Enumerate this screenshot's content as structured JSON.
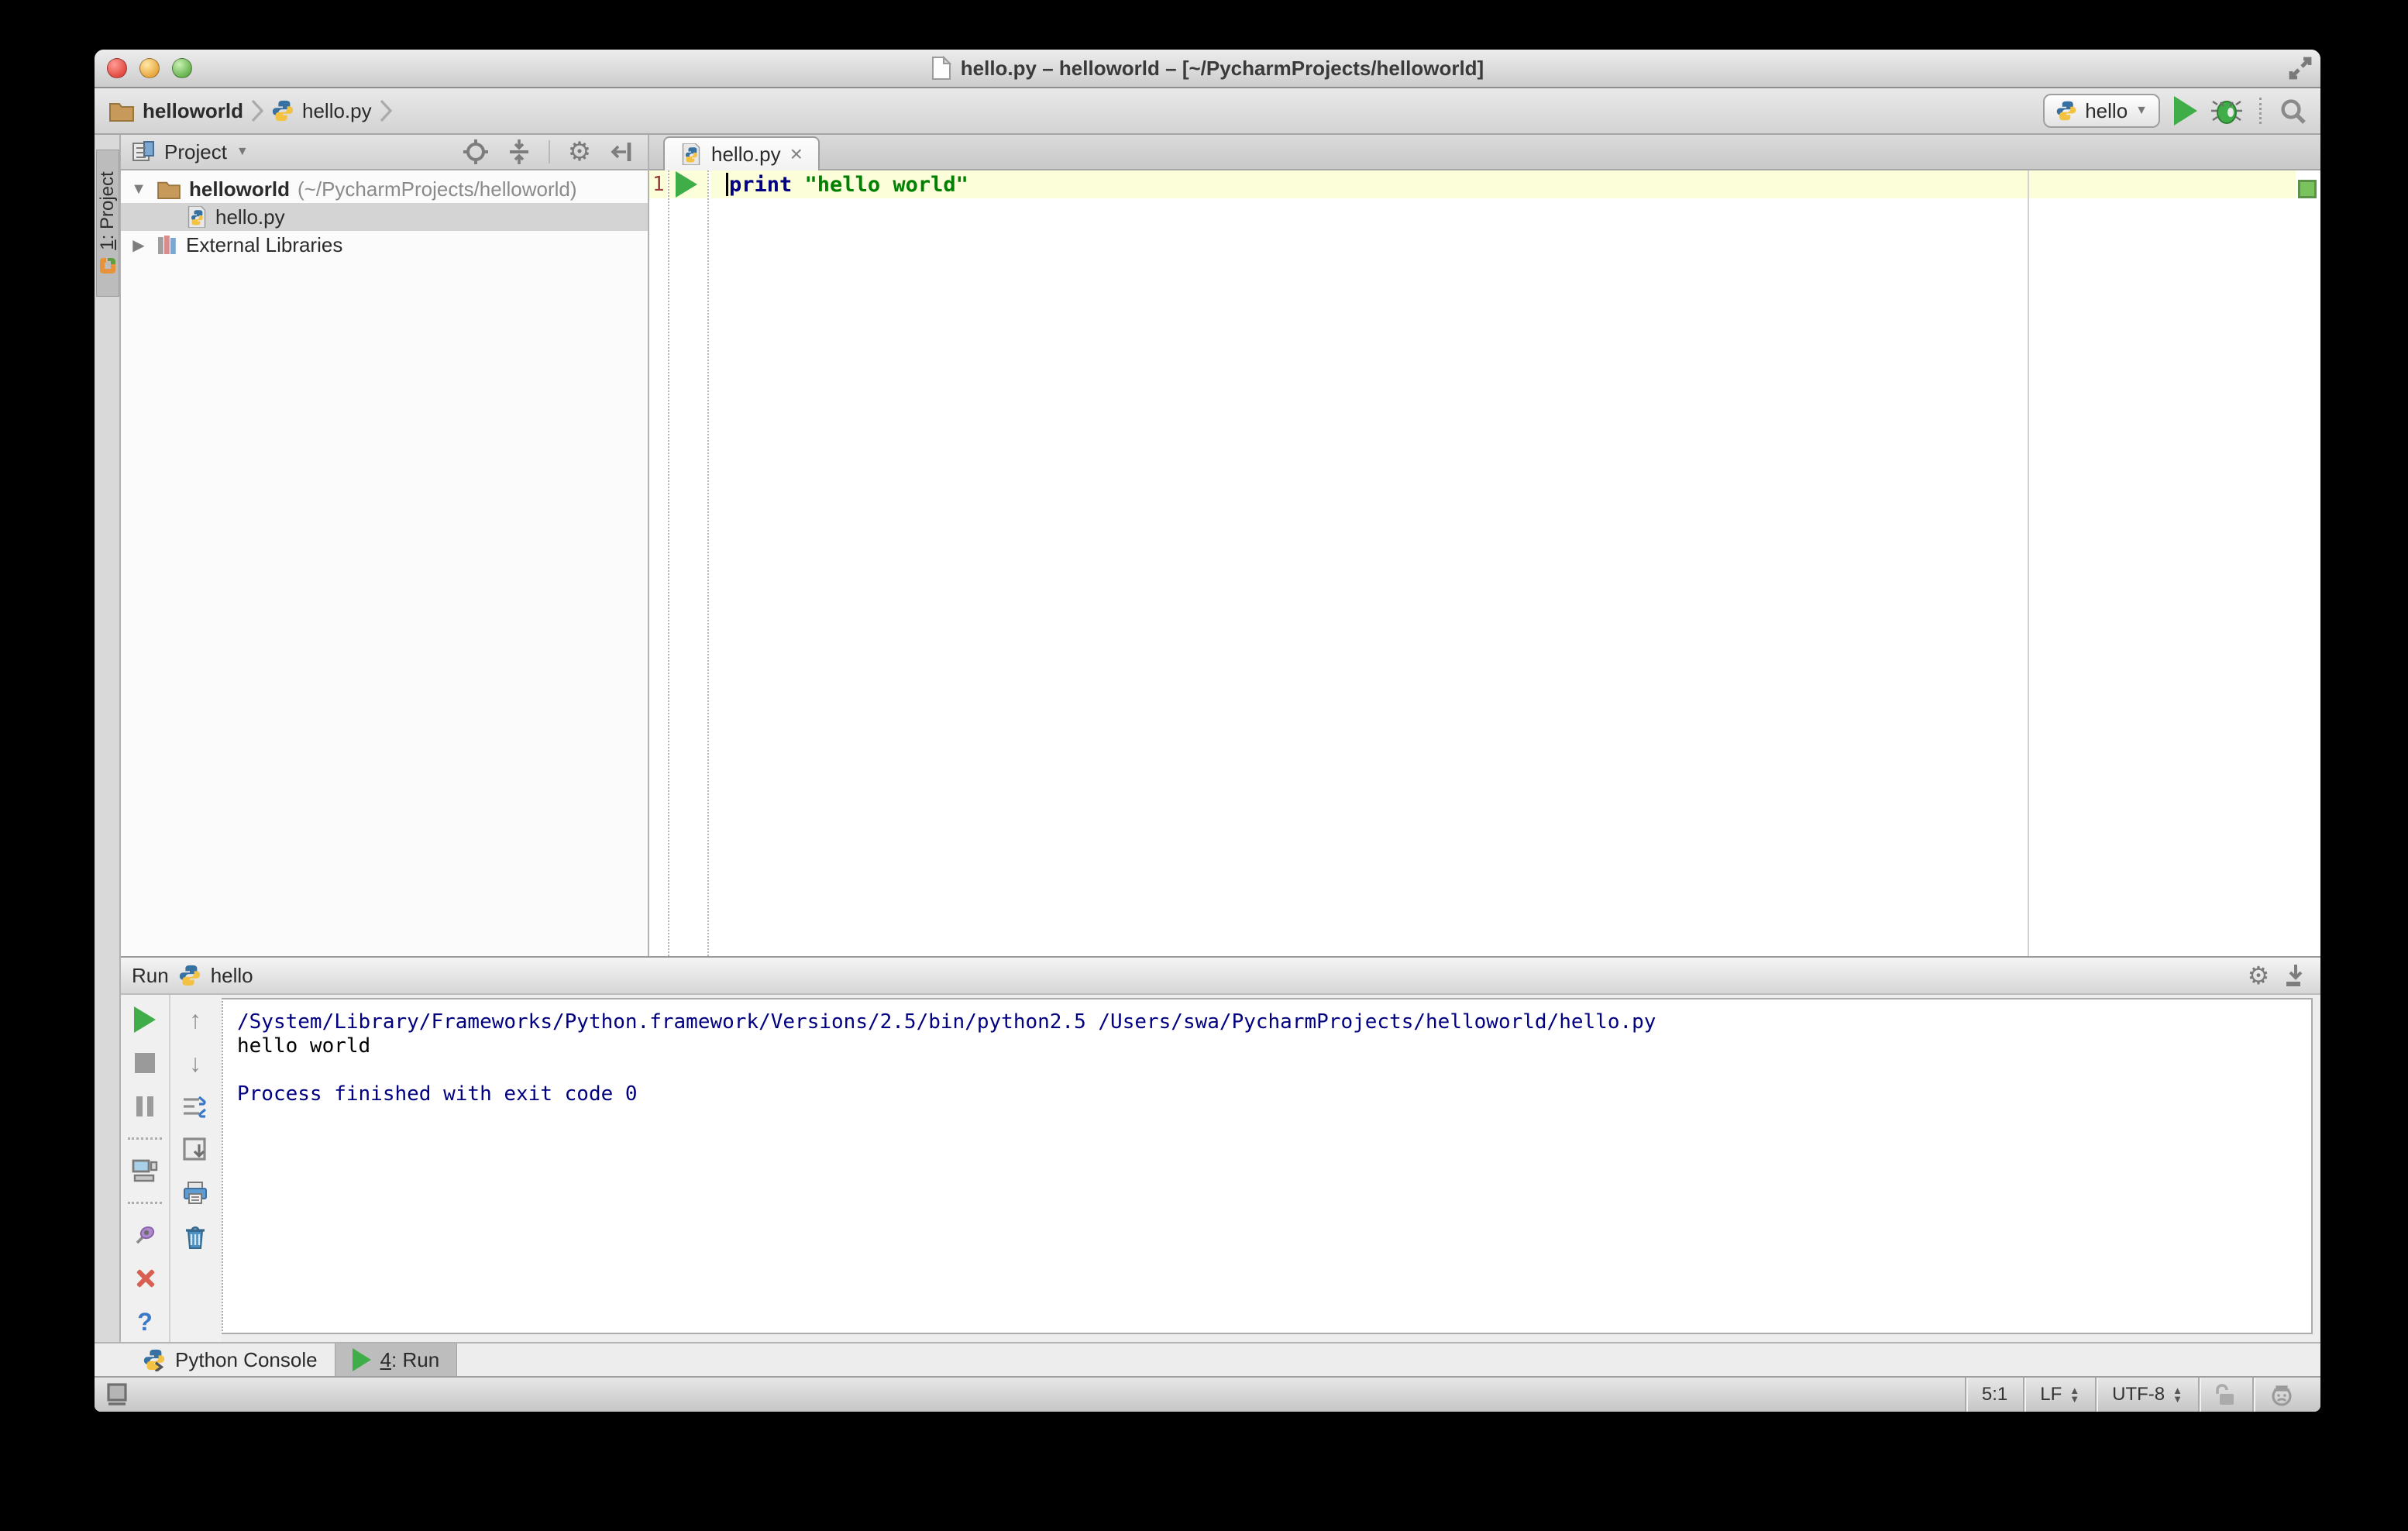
{
  "titlebar": {
    "title": "hello.py – helloworld – [~/PycharmProjects/helloworld]"
  },
  "navbar": {
    "breadcrumb_project": "helloworld",
    "breadcrumb_file": "hello.py",
    "run_config_label": "hello"
  },
  "stripe": {
    "project_button_number": "1",
    "project_button_label": ": Project"
  },
  "project_panel": {
    "header_label": "Project",
    "tree": {
      "root_label": "helloworld",
      "root_path": "(~/PycharmProjects/helloworld)",
      "file_label": "hello.py",
      "libraries_label": "External Libraries"
    }
  },
  "editor": {
    "tab_label": "hello.py",
    "line_number": "1",
    "keyword": "print",
    "string": "\"hello world\""
  },
  "run_panel": {
    "title_label": "Run",
    "config_label": "hello",
    "console_lines": [
      "/System/Library/Frameworks/Python.framework/Versions/2.5/bin/python2.5 /Users/swa/PycharmProjects/helloworld/hello.py",
      "hello world",
      "",
      "Process finished with exit code 0"
    ]
  },
  "bottom_bar": {
    "python_console_label": "Python Console",
    "run_tab_number": "4",
    "run_tab_label": ": Run"
  },
  "status_bar": {
    "caret_position": "5:1",
    "line_separator": "LF",
    "encoding": "UTF-8"
  },
  "icons": {
    "gear": "⚙",
    "dropdown": "▼",
    "spin_up": "▲",
    "spin_down": "▼",
    "up_arrow": "↑",
    "down_arrow": "↓",
    "help": "?",
    "tab_close": "×",
    "tree_expanded": "▼",
    "tree_collapsed": "▶"
  },
  "colors": {
    "run_green": "#3fae49",
    "keyword_blue": "#000080",
    "string_green": "#008000",
    "console_info_blue": "#000080",
    "caret_row_yellow": "#fcfdd9",
    "line_number_red": "#9b3a3a",
    "inspection_ok_green": "#79c25c",
    "selection_gray": "#d4d4d4"
  }
}
